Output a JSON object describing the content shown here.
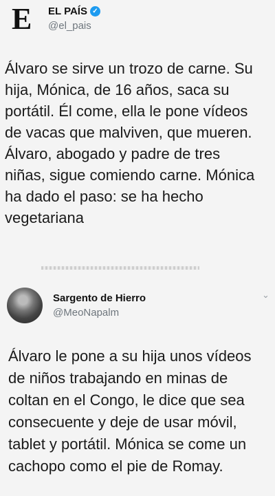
{
  "tweet1": {
    "account_name": "EL PAÍS",
    "handle": "@el_pais",
    "logo_letter": "E",
    "verified_icon": "verified-badge-icon",
    "text": "Álvaro se sirve un trozo de carne. Su\nhija, Mónica, de 16 años, saca su\nportátil. Él come, ella le pone vídeos\nde vacas que malviven, que mueren.\nÁlvaro, abogado y padre de tres\nniñas, sigue comiendo carne. Mónica\nha dado el paso: se ha hecho\nvegetariana"
  },
  "tweet2": {
    "account_name": "Sargento de Hierro",
    "handle": "@MeoNapalm",
    "text": "Álvaro le pone a su hija unos vídeos\nde niños trabajando en minas de\ncoltan en el Congo, le dice que sea\nconsecuente y deje de usar móvil,\ntablet y portátil. Mónica se come un\ncachopo como el pie de Romay.",
    "menu_icon": "chevron-down-icon"
  },
  "colors": {
    "background": "#f4f4f4",
    "text": "#1a1a1a",
    "handle": "#6e767d",
    "verified": "#1d9bf0"
  }
}
